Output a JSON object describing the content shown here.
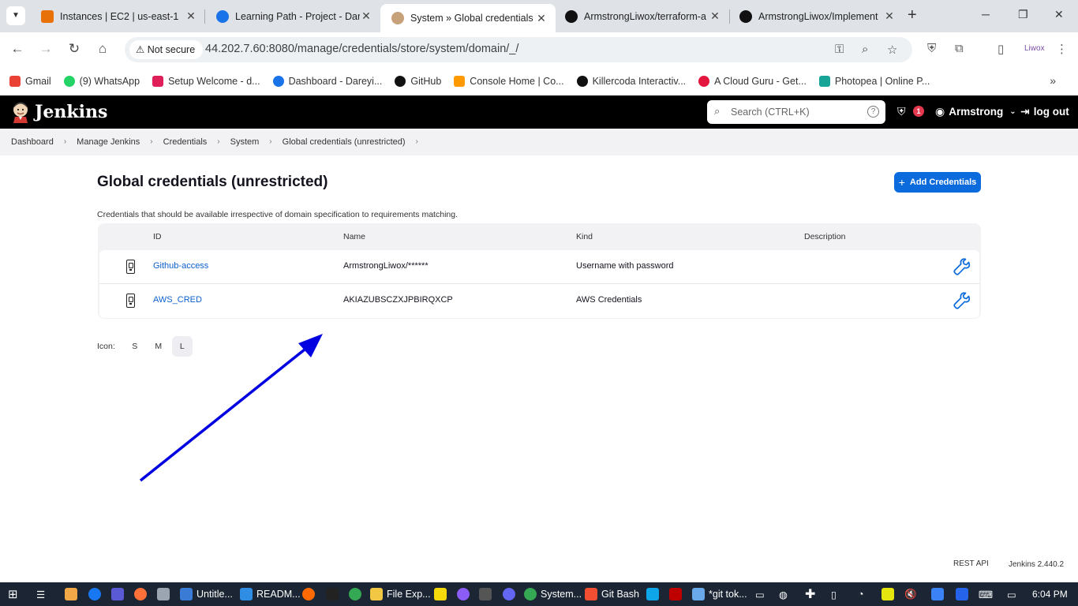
{
  "browser": {
    "tabs": [
      {
        "title": "Instances | EC2 | us-east-1",
        "color": "#e8710a",
        "glyph": "⧉"
      },
      {
        "title": "Learning Path - Project - Dar",
        "color": "#1a73e8",
        "glyph": "◐"
      },
      {
        "title": "System » Global credentials",
        "color": "#c7a17a",
        "glyph": "☺"
      },
      {
        "title": "ArmstrongLiwox/terraform-a",
        "color": "#111111",
        "glyph": "●"
      },
      {
        "title": "ArmstrongLiwox/Implement",
        "color": "#111111",
        "glyph": "●"
      }
    ],
    "security_label": "Not secure",
    "url": "44.202.7.60:8080/manage/credentials/store/system/domain/_/",
    "bookmarks": [
      {
        "label": "Gmail",
        "color": "#ea4335"
      },
      {
        "label": "(9) WhatsApp",
        "color": "#25d366"
      },
      {
        "label": "Setup Welcome - d...",
        "color": "#e01e5a"
      },
      {
        "label": "Dashboard - Dareyi...",
        "color": "#1a73e8"
      },
      {
        "label": "GitHub",
        "color": "#111111"
      },
      {
        "label": "Console Home | Co...",
        "color": "#ff9900"
      },
      {
        "label": "Killercoda Interactiv...",
        "color": "#111111"
      },
      {
        "label": "A Cloud Guru - Get...",
        "color": "#e3163e"
      },
      {
        "label": "Photopea | Online P...",
        "color": "#18a497"
      }
    ]
  },
  "jenkins": {
    "brand": "Jenkins",
    "search_placeholder": "Search (CTRL+K)",
    "help_glyph": "?",
    "alert_count": "1",
    "user": "Armstrong",
    "logout": "log out",
    "breadcrumbs": [
      "Dashboard",
      "Manage Jenkins",
      "Credentials",
      "System",
      "Global credentials (unrestricted)"
    ],
    "page_title": "Global credentials (unrestricted)",
    "add_button": "Add Credentials",
    "description": "Credentials that should be available irrespective of domain specification to requirements matching.",
    "table": {
      "headers": {
        "id": "ID",
        "name": "Name",
        "kind": "Kind",
        "description": "Description"
      },
      "rows": [
        {
          "id": "Github-access",
          "name": "ArmstrongLiwox/******",
          "kind": "Username with password",
          "description": ""
        },
        {
          "id": "AWS_CRED",
          "name": "AKIAZUBSCZXJPBIRQXCP",
          "kind": "AWS Credentials",
          "description": ""
        }
      ]
    },
    "icon_size": {
      "label": "Icon:",
      "options": [
        "S",
        "M",
        "L"
      ],
      "selected": "L"
    },
    "footer": {
      "rest_api": "REST API",
      "version": "Jenkins 2.440.2"
    },
    "colors": {
      "accent": "#0b6bdc",
      "link": "#0b5fcf",
      "annotation_arrow": "#0000e0",
      "badge": "#e6384f"
    }
  },
  "taskbar": {
    "items": [
      {
        "label": "Untitle...",
        "color": "#3a7bd5"
      },
      {
        "label": "READM...",
        "color": "#2f8de4"
      },
      {
        "label": "File Exp...",
        "color": "#f2c744"
      },
      {
        "label": "System...",
        "color": "#34a853"
      },
      {
        "label": "Git Bash",
        "color": "#f14e32"
      },
      {
        "label": "*git tok...",
        "color": "#6aa9e9"
      }
    ],
    "time": "6:04 PM"
  }
}
